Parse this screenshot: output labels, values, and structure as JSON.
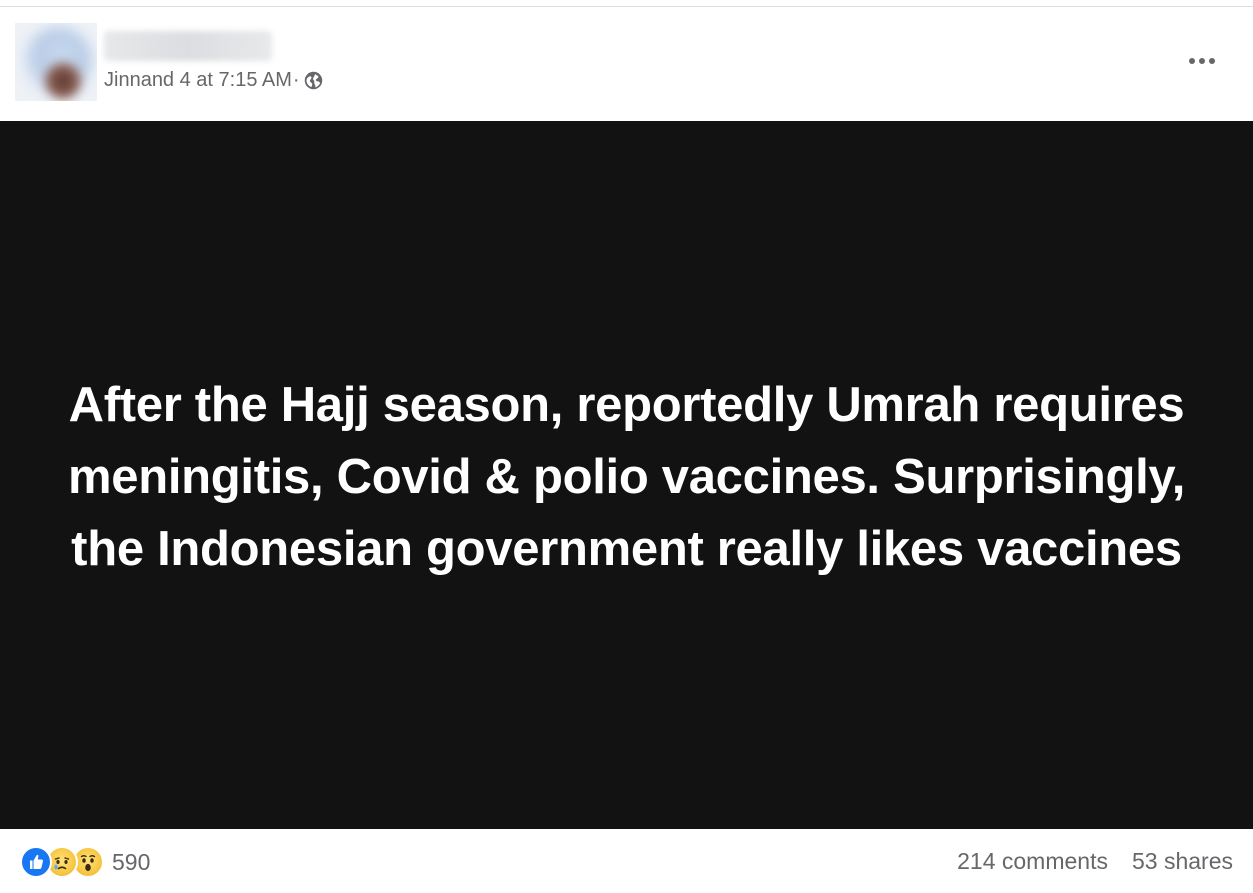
{
  "post": {
    "timestamp": "Jinnand 4 at 7:15 AM",
    "separator": "·",
    "image_text": "After the Hajj season, reportedly Umrah requires meningitis, Covid & polio vaccines. Surprisingly, the Indonesian government really likes vaccines"
  },
  "footer": {
    "reaction_count": "590",
    "comments": "214 comments",
    "shares": "53 shares"
  },
  "icons": {
    "audience": "globe-icon",
    "menu": "more-options-icon",
    "reactions": [
      "like-reaction-icon",
      "sad-reaction-icon",
      "wow-reaction-icon"
    ]
  },
  "colors": {
    "media_background": "#121212",
    "secondary_text": "#65676b",
    "like_blue": "#1877f2",
    "reaction_yellow": "#f7c744"
  }
}
